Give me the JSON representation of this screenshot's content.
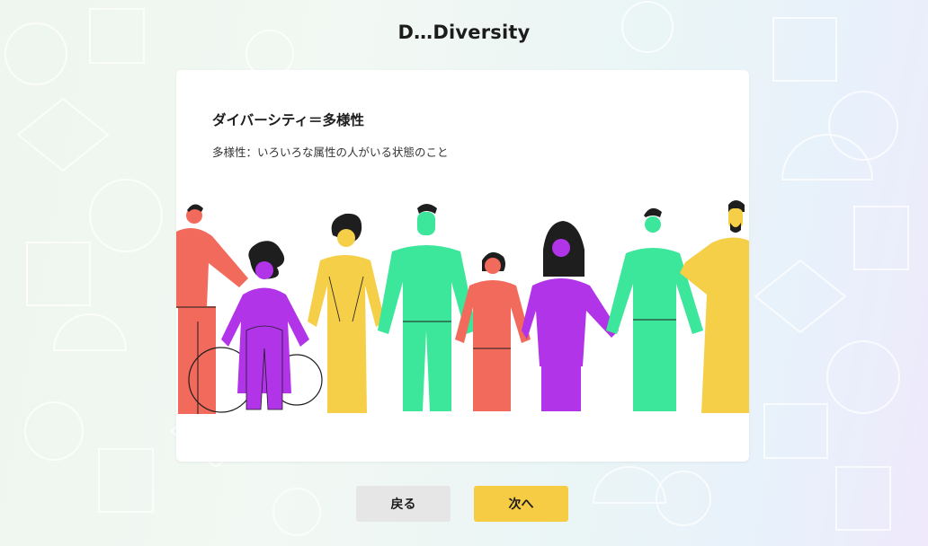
{
  "app": {
    "title": "D…Diversity"
  },
  "card": {
    "heading": "ダイバーシティ＝多様性",
    "description": "多様性：いろいろな属性の人がいる状態のこと"
  },
  "illustration": {
    "icon": "diverse-people-illustration",
    "colors": {
      "red": "#f26a5b",
      "purple": "#b234e8",
      "yellow": "#f6cf48",
      "green": "#3ce69a",
      "dark": "#1e1e1e"
    }
  },
  "buttons": {
    "back_label": "戻る",
    "next_label": "次へ"
  },
  "colors": {
    "accent": "#f6cc44",
    "secondary_button": "#e6e6e6"
  }
}
